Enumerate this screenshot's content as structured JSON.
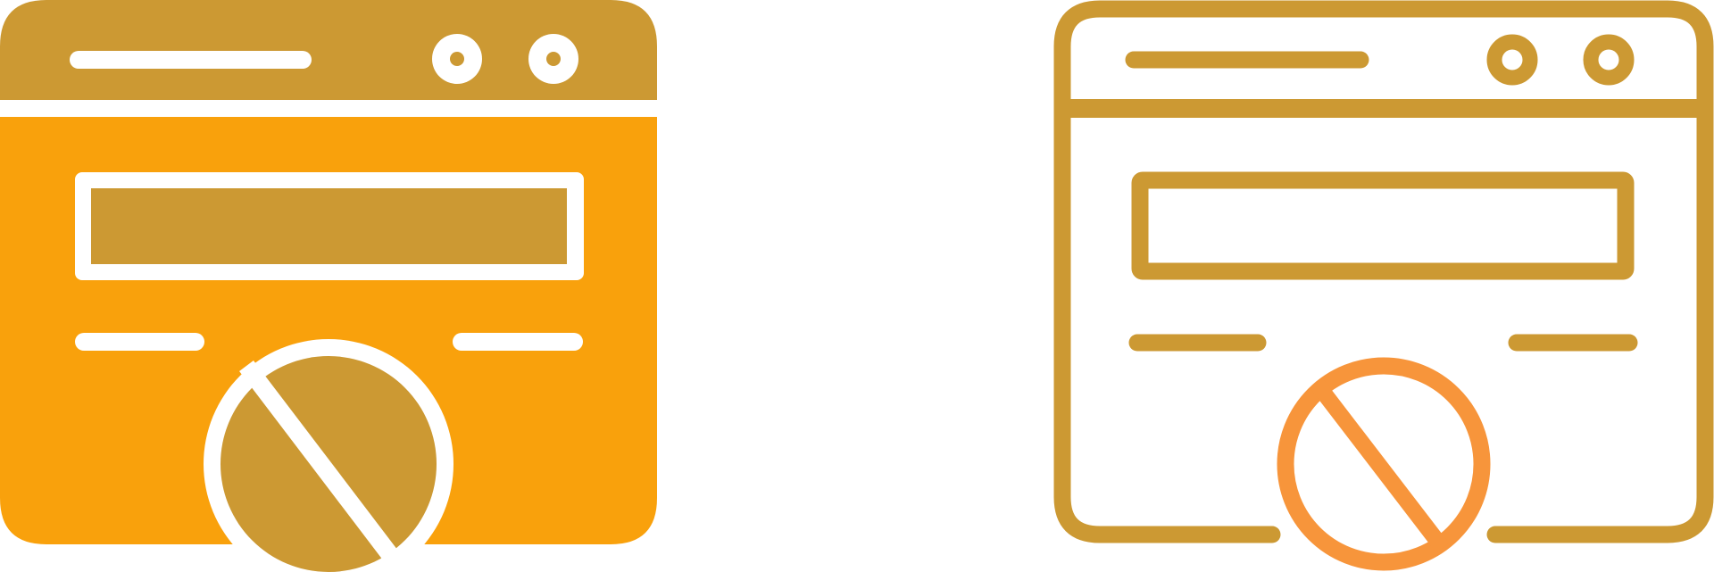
{
  "icons": [
    {
      "name": "blocked-browser-window-glyph-icon",
      "style": "glyph",
      "colors": {
        "frame": "#CC9933",
        "body": "#F9A10C",
        "cutout": "#FFFFFF"
      }
    },
    {
      "name": "blocked-browser-window-outline-icon",
      "style": "outline",
      "colors": {
        "stroke": "#CC9933",
        "accent": "#F7953B",
        "background": "#FFFFFF"
      }
    }
  ]
}
